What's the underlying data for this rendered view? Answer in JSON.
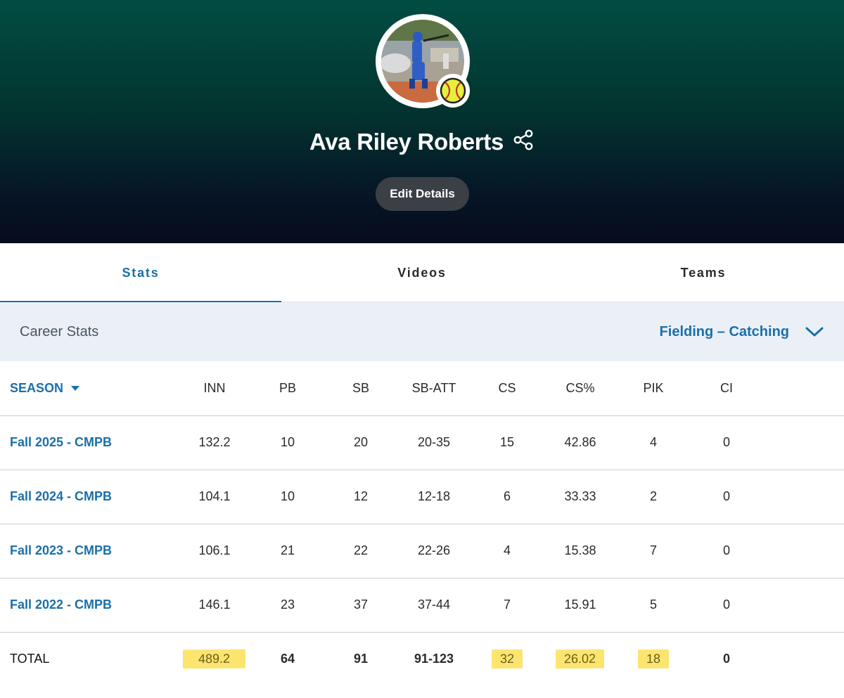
{
  "profile": {
    "name": "Ava Riley Roberts",
    "edit_label": "Edit Details",
    "avatar_icon": "softball-player-photo",
    "badge_icon": "softball-icon",
    "share_icon": "share-icon"
  },
  "tabs": [
    {
      "label": "Stats",
      "active": true
    },
    {
      "label": "Videos",
      "active": false
    },
    {
      "label": "Teams",
      "active": false
    }
  ],
  "career": {
    "title": "Career Stats",
    "filter_label": "Fielding – Catching"
  },
  "table": {
    "season_header": "SEASON",
    "headers": [
      "INN",
      "PB",
      "SB",
      "SB-ATT",
      "CS",
      "CS%",
      "PIK",
      "CI"
    ],
    "rows": [
      {
        "season": "Fall 2025 - CMPB",
        "values": [
          "132.2",
          "10",
          "20",
          "20-35",
          "15",
          "42.86",
          "4",
          "0"
        ]
      },
      {
        "season": "Fall 2024 - CMPB",
        "values": [
          "104.1",
          "10",
          "12",
          "12-18",
          "6",
          "33.33",
          "2",
          "0"
        ]
      },
      {
        "season": "Fall 2023 - CMPB",
        "values": [
          "106.1",
          "21",
          "22",
          "22-26",
          "4",
          "15.38",
          "7",
          "0"
        ]
      },
      {
        "season": "Fall 2022 - CMPB",
        "values": [
          "146.1",
          "23",
          "37",
          "37-44",
          "7",
          "15.91",
          "5",
          "0"
        ]
      }
    ],
    "total": {
      "label": "TOTAL",
      "values": [
        "489.2",
        "64",
        "91",
        "91-123",
        "32",
        "26.02",
        "18",
        "0"
      ]
    }
  },
  "colors": {
    "accent": "#1a6fab",
    "highlight": "#fbe56f",
    "header_top": "#014d43",
    "header_bottom": "#070b1c"
  }
}
